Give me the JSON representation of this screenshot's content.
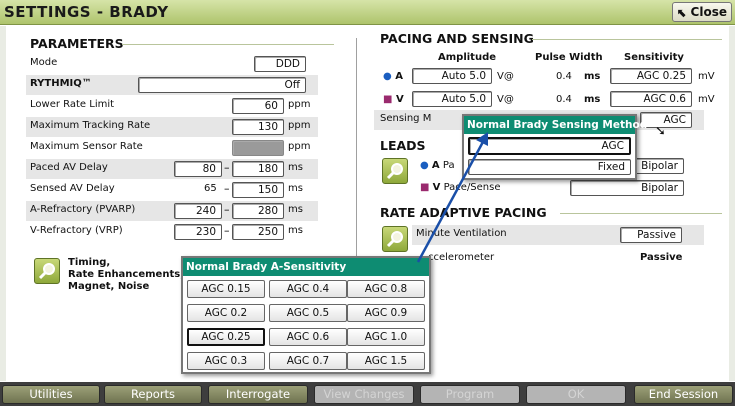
{
  "window": {
    "title": "SETTINGS - BRADY",
    "close_label": "Close"
  },
  "parameters": {
    "heading": "PARAMETERS",
    "mode": {
      "label": "Mode",
      "value": "DDD"
    },
    "rythmiq": {
      "label": "RYTHMIQ™",
      "value": "Off"
    },
    "lower_rate_limit": {
      "label": "Lower Rate Limit",
      "value": "60",
      "unit": "ppm"
    },
    "max_tracking_rate": {
      "label": "Maximum Tracking Rate",
      "value": "130",
      "unit": "ppm"
    },
    "max_sensor_rate": {
      "label": "Maximum Sensor Rate",
      "value": "",
      "unit": "ppm"
    },
    "paced_av_delay": {
      "label": "Paced AV Delay",
      "min": "80",
      "max": "180",
      "unit": "ms"
    },
    "sensed_av_delay": {
      "label": "Sensed AV Delay",
      "min": "65",
      "max": "150",
      "unit": "ms"
    },
    "a_refractory": {
      "label": "A-Refractory (PVARP)",
      "min": "240",
      "max": "280",
      "unit": "ms"
    },
    "v_refractory": {
      "label": "V-Refractory (VRP)",
      "min": "230",
      "max": "250",
      "unit": "ms"
    },
    "timing_link": {
      "line1": "Timing,",
      "line2": "Rate Enhancements,",
      "line3": "Magnet, Noise"
    }
  },
  "pacing_sensing": {
    "heading": "PACING AND SENSING",
    "col_amplitude": "Amplitude",
    "col_pulse_width": "Pulse Width",
    "col_sensitivity": "Sensitivity",
    "a_row": {
      "chamber": "A",
      "amplitude": "Auto 5.0",
      "amp_unit": "V@",
      "pulse_width": "0.4",
      "pw_unit": "ms",
      "sensitivity": "AGC 0.25",
      "sens_unit": "mV"
    },
    "v_row": {
      "chamber": "V",
      "amplitude": "Auto 5.0",
      "amp_unit": "V@",
      "pulse_width": "0.4",
      "pw_unit": "ms",
      "sensitivity": "AGC 0.6",
      "sens_unit": "mV"
    },
    "sensing_method_label": "Sensing M",
    "sensing_method_value": "AGC"
  },
  "leads": {
    "heading": "LEADS",
    "a_label": "Pa",
    "a_value": "Bipolar",
    "v_label": "Pace/Sense",
    "v_value": "Bipolar"
  },
  "rate_adaptive": {
    "heading": "RATE ADAPTIVE PACING",
    "mv_label": "Minute Ventilation",
    "mv_value": "Passive",
    "accel_label": "ccelerometer",
    "accel_value": "Passive"
  },
  "sensing_method_popup": {
    "title": "Normal Brady Sensing Method",
    "options": [
      "AGC",
      "Fixed"
    ],
    "selected": "AGC"
  },
  "a_sensitivity_popup": {
    "title": "Normal Brady A-Sensitivity",
    "options": [
      [
        "AGC 0.15",
        "AGC 0.4",
        "AGC 0.8"
      ],
      [
        "AGC 0.2",
        "AGC 0.5",
        "AGC 0.9"
      ],
      [
        "AGC 0.25",
        "AGC 0.6",
        "AGC 1.0"
      ],
      [
        "AGC 0.3",
        "AGC 0.7",
        "AGC 1.5"
      ]
    ],
    "selected": "AGC 0.25"
  },
  "footer": {
    "utilities": "Utilities",
    "reports": "Reports",
    "interrogate": "Interrogate",
    "view_changes": "View Changes",
    "program": "Program",
    "ok": "OK",
    "end_session": "End Session"
  },
  "colors": {
    "titlebar": "#aec46c",
    "popup_header": "#0e8c72",
    "arrow": "#1a4fa8"
  }
}
